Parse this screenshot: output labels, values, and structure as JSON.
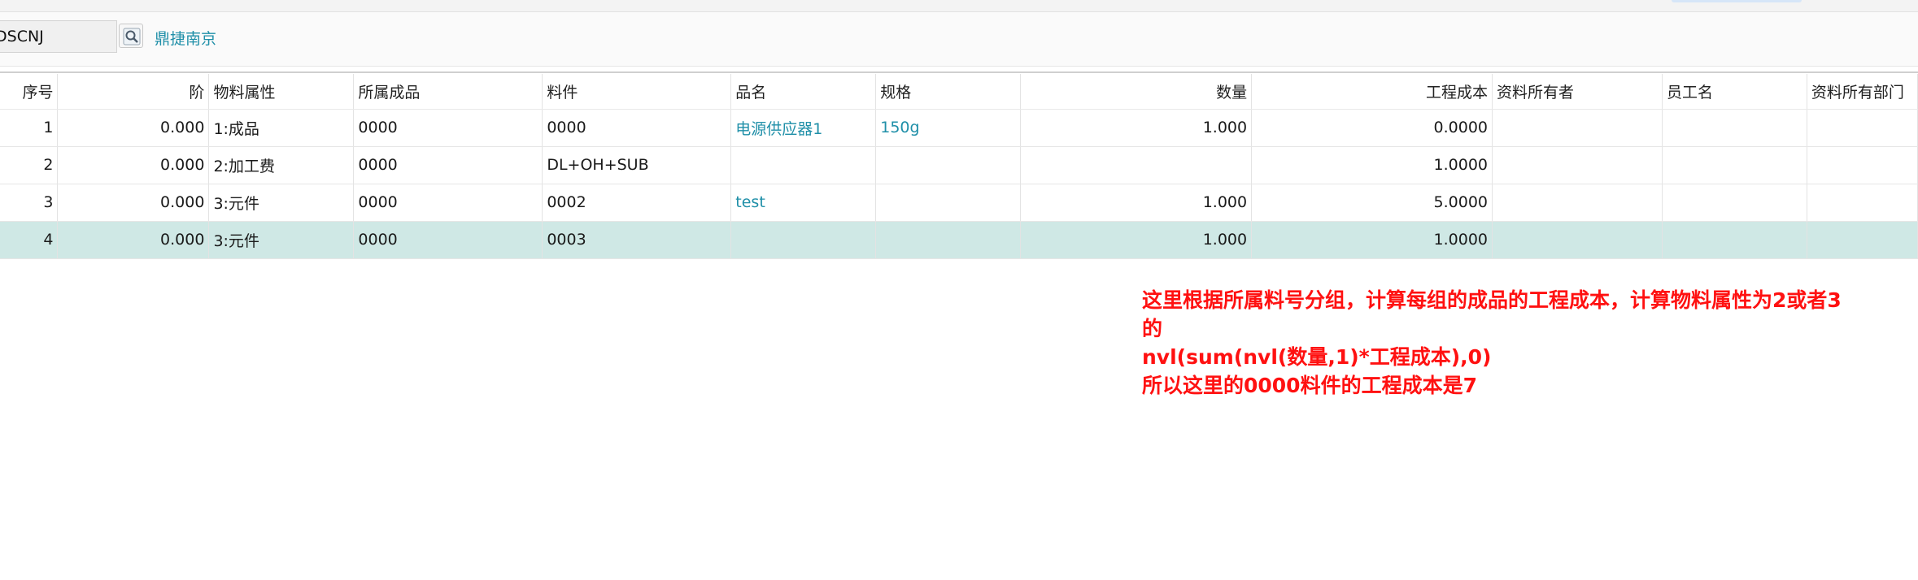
{
  "toolbar": {
    "code_value": "DSCNJ",
    "company_link": "鼎捷南京"
  },
  "grid": {
    "columns": [
      "序号",
      "阶",
      "物料属性",
      "所属成品",
      "料件",
      "品名",
      "规格",
      "数量",
      "工程成本",
      "资料所有者",
      "员工名",
      "资料所有部门"
    ],
    "rows": [
      [
        "1",
        "0.000",
        "1:成品",
        "0000",
        "0000",
        "电源供应器1",
        "150g",
        "1.000",
        "0.0000",
        "",
        "",
        ""
      ],
      [
        "2",
        "0.000",
        "2:加工费",
        "0000",
        "DL+OH+SUB",
        "",
        "",
        "",
        "1.0000",
        "",
        "",
        ""
      ],
      [
        "3",
        "0.000",
        "3:元件",
        "0000",
        "0002",
        "test",
        "",
        "1.000",
        "5.0000",
        "",
        "",
        ""
      ],
      [
        "4",
        "0.000",
        "3:元件",
        "0000",
        "0003",
        "",
        "",
        "1.000",
        "1.0000",
        "",
        "",
        ""
      ]
    ],
    "selected_row": 4
  },
  "annotation": {
    "lines": [
      "这里根据所属料号分组，计算每组的成品的工程成本，计算物料属性为2或者3",
      "的",
      "nvl(sum(nvl(数量,1)*工程成本),0)",
      "所以这里的0000料件的工程成本是7"
    ]
  }
}
